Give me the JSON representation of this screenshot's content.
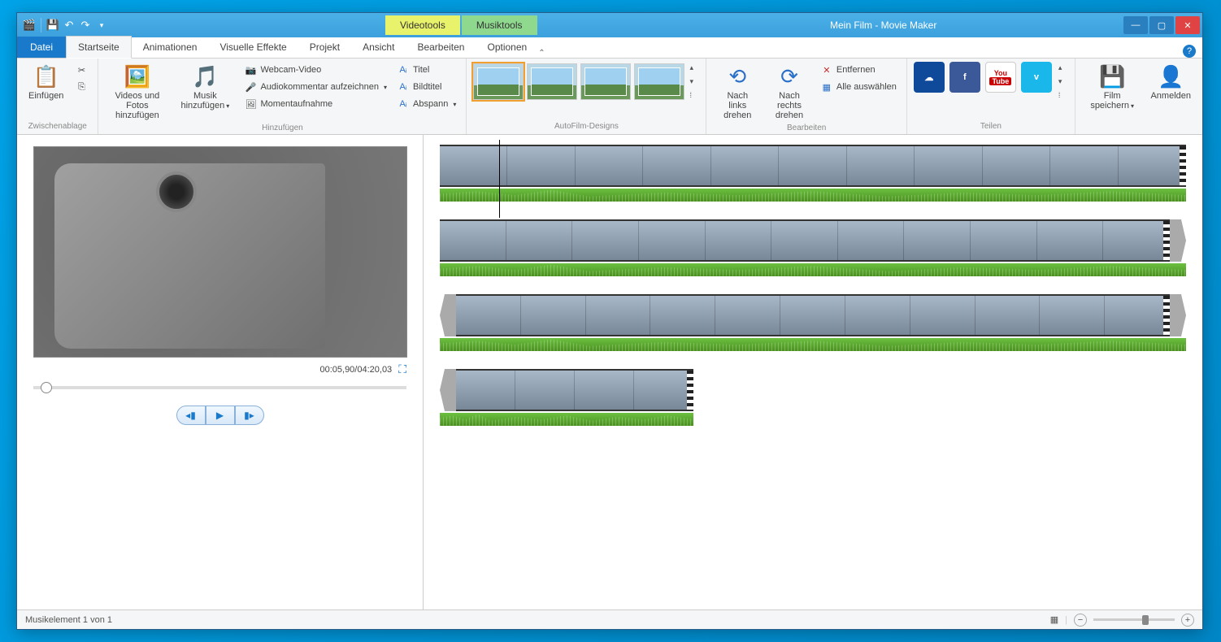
{
  "window": {
    "title": "Mein Film - Movie Maker"
  },
  "contextual": {
    "video": "Videotools",
    "music": "Musiktools"
  },
  "tabs": {
    "file": "Datei",
    "start": "Startseite",
    "anim": "Animationen",
    "vfx": "Visuelle Effekte",
    "project": "Projekt",
    "view": "Ansicht",
    "edit": "Bearbeiten",
    "options": "Optionen"
  },
  "ribbon": {
    "clipboard": {
      "label": "Zwischenablage",
      "paste": "Einfügen"
    },
    "add": {
      "label": "Hinzufügen",
      "videos": "Videos und Fotos hinzufügen",
      "music": "Musik hinzufügen",
      "webcam": "Webcam-Video",
      "audiorecord": "Audiokommentar aufzeichnen",
      "snapshot": "Momentaufnahme",
      "title": "Titel",
      "caption": "Bildtitel",
      "credits": "Abspann"
    },
    "autodesigns": {
      "label": "AutoFilm-Designs"
    },
    "edit": {
      "label": "Bearbeiten",
      "rotleft": "Nach links drehen",
      "rotright": "Nach rechts drehen",
      "remove": "Entfernen",
      "selectall": "Alle auswählen"
    },
    "share": {
      "label": "Teilen"
    },
    "save": {
      "film": "Film speichern",
      "signin": "Anmelden"
    }
  },
  "preview": {
    "time": "00:05,90/04:20,03"
  },
  "status": {
    "text": "Musikelement 1 von 1"
  }
}
